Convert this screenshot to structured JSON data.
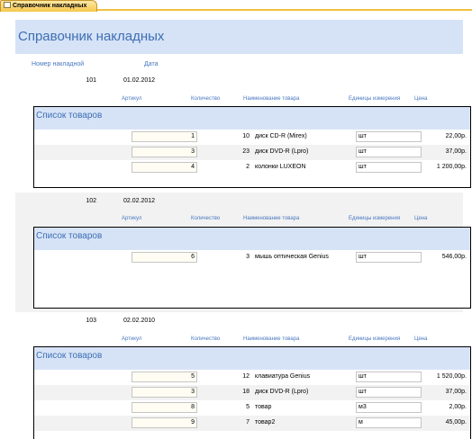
{
  "tab": {
    "title": "Справочник накладных"
  },
  "form": {
    "title": "Справочник накладных",
    "label_number": "Номер накладной",
    "label_date": "Дата"
  },
  "columns": {
    "article": "Артикул",
    "quantity": "Количество",
    "name": "Наименование товара",
    "unit": "Единицы измерения",
    "price": "Цена"
  },
  "subform_title": "Список товаров",
  "records": [
    {
      "number": "101",
      "date": "01.02.2012",
      "items": [
        {
          "article": "1",
          "quantity": "10",
          "name": "диск CD-R (Mirex)",
          "unit": "шт",
          "price": "22,00р."
        },
        {
          "article": "3",
          "quantity": "23",
          "name": "диск DVD-R (Lpro)",
          "unit": "шт",
          "price": "37,00р."
        },
        {
          "article": "4",
          "quantity": "2",
          "name": "колонки LUXEON",
          "unit": "шт",
          "price": "1 200,00р."
        }
      ]
    },
    {
      "number": "102",
      "date": "02.02.2012",
      "items": [
        {
          "article": "6",
          "quantity": "3",
          "name": "мышь оптическая Genius",
          "unit": "шт",
          "price": "546,00р."
        }
      ]
    },
    {
      "number": "103",
      "date": "02.02.2010",
      "items": [
        {
          "article": "5",
          "quantity": "12",
          "name": "клавиатура Genius",
          "unit": "шт",
          "price": "1 520,00р."
        },
        {
          "article": "3",
          "quantity": "18",
          "name": "диск DVD-R (Lpro)",
          "unit": "шт",
          "price": "37,00р."
        },
        {
          "article": "8",
          "quantity": "5",
          "name": "товар",
          "unit": "м3",
          "price": "2,00р."
        },
        {
          "article": "9",
          "quantity": "7",
          "name": "товар2",
          "unit": "м",
          "price": "45,00р."
        }
      ]
    }
  ]
}
